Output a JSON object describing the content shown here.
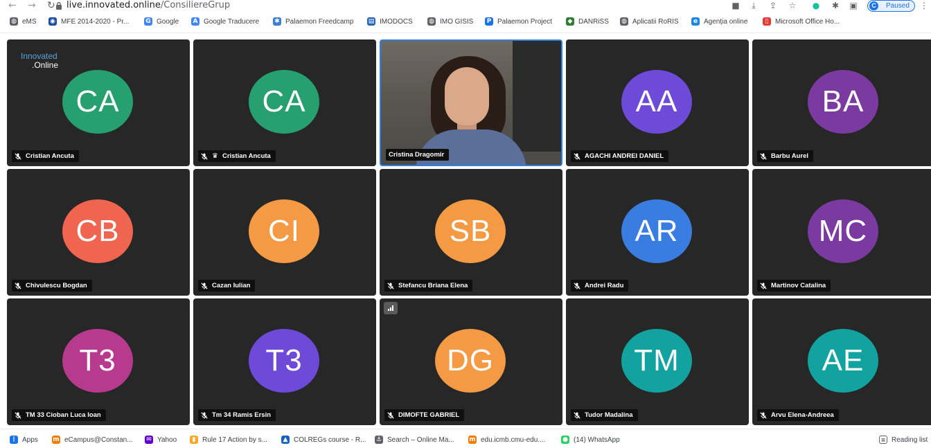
{
  "browser": {
    "url_host": "live.innovated.online",
    "url_path": "/ConsiliereGrup",
    "profile_initial": "C",
    "profile_status": "Paused"
  },
  "bookmarks_top": [
    {
      "label": "eMS",
      "icon": "globe-icon",
      "color": "#5f6368"
    },
    {
      "label": "MFE 2014-2020 - Pr...",
      "icon": "circle-logo-icon",
      "color": "#1a4f9c"
    },
    {
      "label": "Google",
      "icon": "google-icon",
      "color": "#4285f4"
    },
    {
      "label": "Google Traducere",
      "icon": "translate-icon",
      "color": "#4285f4"
    },
    {
      "label": "Palaemon Freedcamp",
      "icon": "freedcamp-icon",
      "color": "#3b7dd8"
    },
    {
      "label": "IMODOCS",
      "icon": "docs-icon",
      "color": "#2a66b8"
    },
    {
      "label": "IMO GISIS",
      "icon": "globe-icon",
      "color": "#5f6368"
    },
    {
      "label": "Palaemon Project",
      "icon": "p-logo-icon",
      "color": "#1a73e8"
    },
    {
      "label": "DANRiSS",
      "icon": "fish-icon",
      "color": "#2e7d32"
    },
    {
      "label": "Aplicatii RoRIS",
      "icon": "globe-icon",
      "color": "#5f6368"
    },
    {
      "label": "Agenția online",
      "icon": "edge-icon",
      "color": "#1e88e5"
    },
    {
      "label": "Microsoft Office Ho...",
      "icon": "office-icon",
      "color": "#e53935"
    }
  ],
  "bookmarks_bottom": [
    {
      "label": "Apps",
      "icon": "apps-grid-icon",
      "color": "#1a73e8"
    },
    {
      "label": "eCampus@Constan...",
      "icon": "moodle-icon",
      "color": "#f57c00"
    },
    {
      "label": "Yahoo",
      "icon": "mail-icon",
      "color": "#6001d2"
    },
    {
      "label": "Rule 17 Action by s...",
      "icon": "bars-icon",
      "color": "#f9a825"
    },
    {
      "label": "COLREGs course - R...",
      "icon": "ship-icon",
      "color": "#1565c0"
    },
    {
      "label": "Search – Online Ma...",
      "icon": "anchor-icon",
      "color": "#5f6368"
    },
    {
      "label": "edu.icmb.cmu-edu....",
      "icon": "moodle-icon",
      "color": "#f57c00"
    },
    {
      "label": "(14) WhatsApp",
      "icon": "whatsapp-icon",
      "color": "#25d366"
    }
  ],
  "reading_list": "Reading list",
  "meeting": {
    "logo_line1": "Innovated",
    "logo_line2": ".Online",
    "participants": [
      {
        "initials": "CA",
        "name": "Cristian Ancuta",
        "color": "#27a06f",
        "muted": true,
        "moderator": false
      },
      {
        "initials": "CA",
        "name": "Cristian Ancuta",
        "color": "#27a06f",
        "muted": true,
        "moderator": true
      },
      {
        "initials": "",
        "name": "Cristina Dragomir",
        "color": "#000000",
        "muted": false,
        "video": true,
        "speaking": true
      },
      {
        "initials": "AA",
        "name": "AGACHI ANDREI DANIEL",
        "color": "#6d4bd8",
        "muted": true
      },
      {
        "initials": "BA",
        "name": "Barbu Aurel",
        "color": "#7b3aa0",
        "muted": true
      },
      {
        "initials": "CB",
        "name": "Chivulescu Bogdan",
        "color": "#f0654f",
        "muted": true
      },
      {
        "initials": "CI",
        "name": "Cazan Iulian",
        "color": "#f59a44",
        "muted": true
      },
      {
        "initials": "SB",
        "name": "Stefancu Briana Elena",
        "color": "#f59a44",
        "muted": true
      },
      {
        "initials": "AR",
        "name": "Andrei Radu",
        "color": "#3a7de0",
        "muted": true
      },
      {
        "initials": "MC",
        "name": "Martinov Catalina",
        "color": "#7b3aa0",
        "muted": true
      },
      {
        "initials": "T3",
        "name": "TM 33 Cioban Luca Ioan",
        "color": "#b83a8e",
        "muted": true
      },
      {
        "initials": "T3",
        "name": "Tm 34 Ramis Ersin",
        "color": "#6d4bd8",
        "muted": true
      },
      {
        "initials": "DG",
        "name": "DIMOFTE GABRIEL",
        "color": "#f59a44",
        "muted": true,
        "signal": true
      },
      {
        "initials": "TM",
        "name": "Tudor Madalina",
        "color": "#12a3a0",
        "muted": true
      },
      {
        "initials": "AE",
        "name": "Arvu Elena-Andreea",
        "color": "#12a3a0",
        "muted": true
      }
    ]
  }
}
